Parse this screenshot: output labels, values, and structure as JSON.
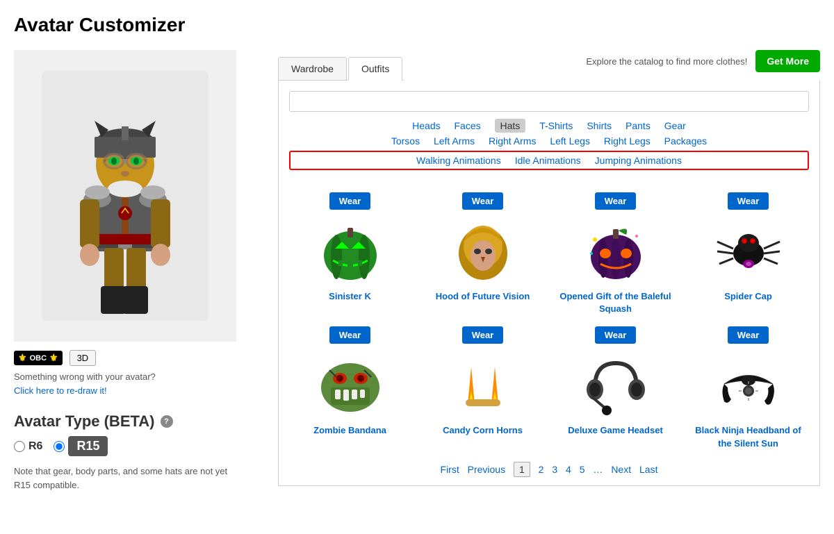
{
  "page": {
    "title": "Avatar Customizer"
  },
  "left_panel": {
    "obc_badge": "OBC",
    "btn_3d": "3D",
    "wrong_text": "Something wrong with your avatar?",
    "redraw_link": "Click here to re-draw it!",
    "avatar_type_title": "Avatar Type (BETA)",
    "r6_label": "R6",
    "r15_label": "R15",
    "r15_selected": true,
    "avatar_note": "Note that gear, body parts, and some hats are not yet R15 compatible."
  },
  "right_panel": {
    "tabs": [
      {
        "id": "wardrobe",
        "label": "Wardrobe",
        "active": false
      },
      {
        "id": "outfits",
        "label": "Outfits",
        "active": true
      }
    ],
    "catalog_text": "Explore the catalog to find more clothes!",
    "btn_get_more": "Get More",
    "search_placeholder": "",
    "categories_row1": [
      {
        "id": "heads",
        "label": "Heads",
        "active": false
      },
      {
        "id": "faces",
        "label": "Faces",
        "active": false
      },
      {
        "id": "hats",
        "label": "Hats",
        "active": true
      },
      {
        "id": "tshirts",
        "label": "T-Shirts",
        "active": false
      },
      {
        "id": "shirts",
        "label": "Shirts",
        "active": false
      },
      {
        "id": "pants",
        "label": "Pants",
        "active": false
      },
      {
        "id": "gear",
        "label": "Gear",
        "active": false
      }
    ],
    "categories_row2": [
      {
        "id": "torsos",
        "label": "Torsos",
        "active": false
      },
      {
        "id": "left-arms",
        "label": "Left Arms",
        "active": false
      },
      {
        "id": "right-arms",
        "label": "Right Arms",
        "active": false
      },
      {
        "id": "left-legs",
        "label": "Left Legs",
        "active": false
      },
      {
        "id": "right-legs",
        "label": "Right Legs",
        "active": false
      },
      {
        "id": "packages",
        "label": "Packages",
        "active": false
      }
    ],
    "animations": [
      {
        "id": "walking",
        "label": "Walking Animations"
      },
      {
        "id": "idle",
        "label": "Idle Animations"
      },
      {
        "id": "jumping",
        "label": "Jumping Animations"
      }
    ],
    "items": [
      {
        "id": "sinister-k",
        "name": "Sinister K",
        "wear_label": "Wear",
        "color": "#228B22",
        "shape": "pumpkin_green"
      },
      {
        "id": "hood-future-vision",
        "name": "Hood of Future Vision",
        "wear_label": "Wear",
        "color": "#DAA520",
        "shape": "hood_yellow"
      },
      {
        "id": "opened-gift-baleful-squash",
        "name": "Opened Gift of the Baleful Squash",
        "wear_label": "Wear",
        "color": "#6B2E8A",
        "shape": "pumpkin_dark"
      },
      {
        "id": "spider-cap",
        "name": "Spider Cap",
        "wear_label": "Wear",
        "color": "#222222",
        "shape": "spider"
      },
      {
        "id": "zombie-bandana",
        "name": "Zombie Bandana",
        "wear_label": "Wear",
        "color": "#4B7A4B",
        "shape": "bandana_green"
      },
      {
        "id": "candy-corn-horns",
        "name": "Candy Corn Horns",
        "wear_label": "Wear",
        "color": "#E8C44B",
        "shape": "candy_corn"
      },
      {
        "id": "deluxe-game-headset",
        "name": "Deluxe Game Headset",
        "wear_label": "Wear",
        "color": "#333333",
        "shape": "headset"
      },
      {
        "id": "black-ninja-headband",
        "name": "Black Ninja Headband of the Silent Sun",
        "wear_label": "Wear",
        "color": "#111111",
        "shape": "headband"
      }
    ],
    "pagination": {
      "first": "First",
      "previous": "Previous",
      "pages": [
        "1",
        "2",
        "3",
        "4",
        "5"
      ],
      "current": "1",
      "ellipsis": "…",
      "next": "Next",
      "last": "Last"
    }
  },
  "colors": {
    "accent_blue": "#0066cc",
    "accent_green": "#00aa00",
    "tab_active_bg": "#ffffff",
    "tab_inactive_bg": "#f5f5f5",
    "wear_btn": "#0066cc",
    "animation_border": "#ff0000"
  }
}
